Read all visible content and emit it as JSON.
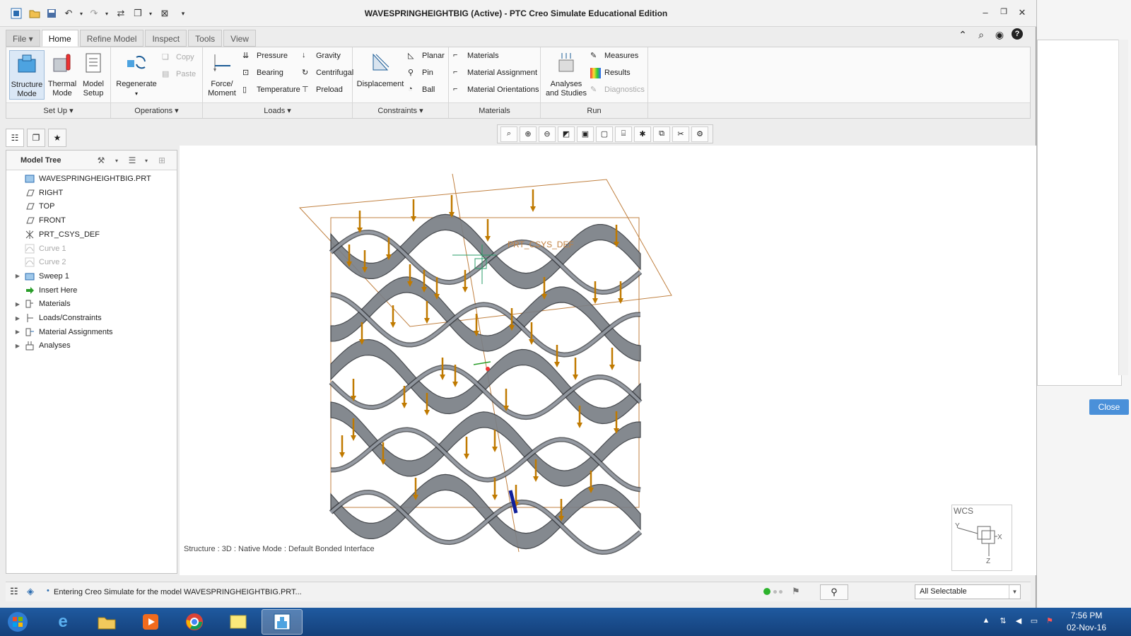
{
  "window": {
    "title": "WAVESPRINGHEIGHTBIG (Active) - PTC Creo Simulate Educational Edition"
  },
  "tabs": [
    "File",
    "Home",
    "Refine Model",
    "Inspect",
    "Tools",
    "View"
  ],
  "ribbon": {
    "setup": {
      "label": "Set Up",
      "structure_mode": "Structure Mode",
      "thermal_mode": "Thermal Mode",
      "model_setup": "Model Setup"
    },
    "operations": {
      "label": "Operations",
      "regenerate": "Regenerate",
      "copy": "Copy",
      "paste": "Paste"
    },
    "loads": {
      "label": "Loads",
      "force_moment": "Force/ Moment",
      "pressure": "Pressure",
      "bearing": "Bearing",
      "temperature": "Temperature",
      "gravity": "Gravity",
      "centrifugal": "Centrifugal",
      "preload": "Preload"
    },
    "constraints": {
      "label": "Constraints",
      "displacement": "Displacement",
      "planar": "Planar",
      "pin": "Pin",
      "ball": "Ball"
    },
    "materials": {
      "label": "Materials",
      "materials": "Materials",
      "material_assignment": "Material Assignment",
      "material_orientations": "Material Orientations"
    },
    "run": {
      "label": "Run",
      "analyses": "Analyses and Studies",
      "measures": "Measures",
      "results": "Results",
      "diagnostics": "Diagnostics"
    }
  },
  "model_tree": {
    "title": "Model Tree",
    "items": [
      {
        "label": "WAVESPRINGHEIGHTBIG.PRT",
        "icon": "part-icon"
      },
      {
        "label": "RIGHT",
        "icon": "datum-plane-icon"
      },
      {
        "label": "TOP",
        "icon": "datum-plane-icon"
      },
      {
        "label": "FRONT",
        "icon": "datum-plane-icon"
      },
      {
        "label": "PRT_CSYS_DEF",
        "icon": "csys-icon"
      },
      {
        "label": "Curve 1",
        "icon": "curve-icon"
      },
      {
        "label": "Curve 2",
        "icon": "curve-icon"
      },
      {
        "label": "Sweep 1",
        "icon": "sweep-icon"
      },
      {
        "label": "Insert Here",
        "icon": "insert-arrow-icon"
      },
      {
        "label": "Materials",
        "icon": "materials-icon"
      },
      {
        "label": "Loads/Constraints",
        "icon": "loads-icon"
      },
      {
        "label": "Material Assignments",
        "icon": "material-assignment-icon"
      },
      {
        "label": "Analyses",
        "icon": "analyses-icon"
      }
    ]
  },
  "graphics": {
    "csys_label": "PRT_CSYS_DEF",
    "mode_status": "Structure : 3D : Native Mode : Default Bonded Interface",
    "wcs_label": "WCS"
  },
  "statusbar": {
    "message": "Entering Creo Simulate for the model WAVESPRINGHEIGHTBIG.PRT...",
    "filter": "All Selectable"
  },
  "background_window": {
    "close_label": "Close"
  },
  "taskbar": {
    "time": "7:56 PM",
    "date": "02-Nov-16"
  },
  "colors": {
    "accent": "#4a90d9",
    "load_arrow": "#c07a00",
    "spring_metal": "#7a7f86"
  }
}
